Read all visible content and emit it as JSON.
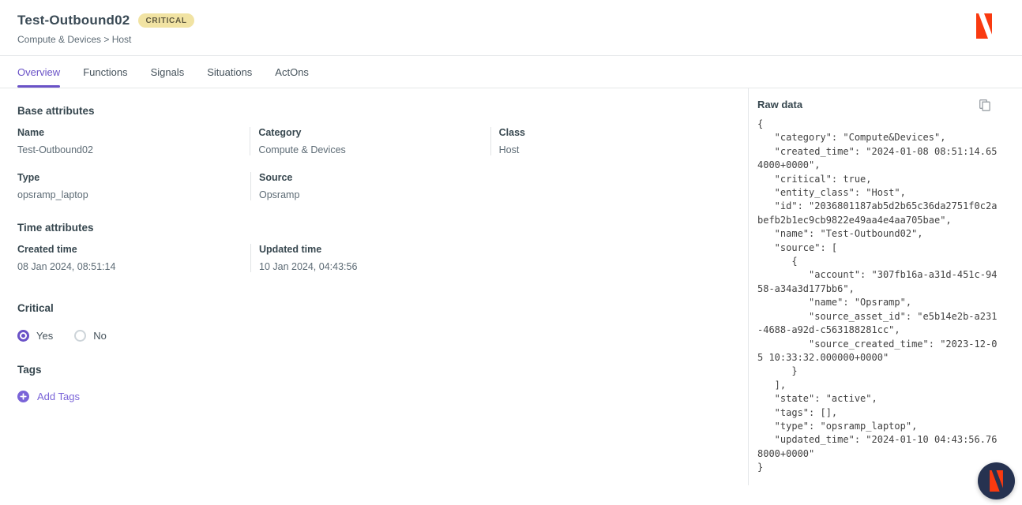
{
  "colors": {
    "accent_purple": "#6a52c7",
    "link_purple": "#7a64d8",
    "badge_bg": "#f1e3a3",
    "badge_text": "#605a40",
    "logo_orange": "#f93a10",
    "fab_navy": "#263250",
    "divider": "#e5e7e9"
  },
  "icons": {
    "brand_logo": "brand-logo-icon",
    "copy": "copy-icon",
    "plus": "plus-icon",
    "fab_logo": "brand-logo-icon"
  },
  "header": {
    "title": "Test-Outbound02",
    "status_badge": "CRITICAL",
    "breadcrumb": "Compute & Devices > Host"
  },
  "tabs": [
    {
      "label": "Overview",
      "active": true
    },
    {
      "label": "Functions",
      "active": false
    },
    {
      "label": "Signals",
      "active": false
    },
    {
      "label": "Situations",
      "active": false
    },
    {
      "label": "ActOns",
      "active": false
    }
  ],
  "base_attributes": {
    "heading": "Base attributes",
    "fields": [
      {
        "label": "Name",
        "value": "Test-Outbound02"
      },
      {
        "label": "Category",
        "value": "Compute & Devices"
      },
      {
        "label": "Class",
        "value": "Host"
      },
      {
        "label": "Type",
        "value": "opsramp_laptop"
      },
      {
        "label": "Source",
        "value": "Opsramp"
      }
    ]
  },
  "time_attributes": {
    "heading": "Time attributes",
    "fields": [
      {
        "label": "Created time",
        "value": "08 Jan 2024, 08:51:14"
      },
      {
        "label": "Updated time",
        "value": "10 Jan 2024, 04:43:56"
      }
    ]
  },
  "critical": {
    "heading": "Critical",
    "options": [
      {
        "label": "Yes",
        "selected": true
      },
      {
        "label": "No",
        "selected": false
      }
    ]
  },
  "tags": {
    "heading": "Tags",
    "add_label": "Add Tags"
  },
  "raw_panel": {
    "heading": "Raw data",
    "json_text": "{\n   \"category\": \"Compute&Devices\",\n   \"created_time\": \"2024-01-08 08:51:14.65\n4000+0000\",\n   \"critical\": true,\n   \"entity_class\": \"Host\",\n   \"id\": \"2036801187ab5d2b65c36da2751f0c2a\nbefb2b1ec9cb9822e49aa4e4aa705bae\",\n   \"name\": \"Test-Outbound02\",\n   \"source\": [\n      {\n         \"account\": \"307fb16a-a31d-451c-94\n58-a34a3d177bb6\",\n         \"name\": \"Opsramp\",\n         \"source_asset_id\": \"e5b14e2b-a231\n-4688-a92d-c563188281cc\",\n         \"source_created_time\": \"2023-12-0\n5 10:33:32.000000+0000\"\n      }\n   ],\n   \"state\": \"active\",\n   \"tags\": [],\n   \"type\": \"opsramp_laptop\",\n   \"updated_time\": \"2024-01-10 04:43:56.76\n8000+0000\"\n}"
  }
}
